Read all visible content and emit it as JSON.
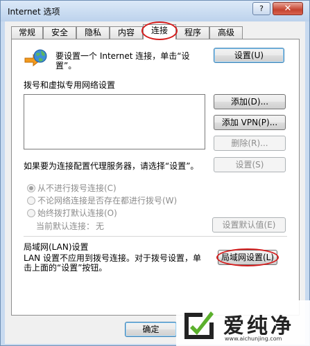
{
  "window": {
    "title": "Internet 选项",
    "help_label": "?",
    "close_label": "✕"
  },
  "tabs": [
    {
      "label": "常规"
    },
    {
      "label": "安全"
    },
    {
      "label": "隐私"
    },
    {
      "label": "内容"
    },
    {
      "label": "连接",
      "active": true
    },
    {
      "label": "程序"
    },
    {
      "label": "高级"
    }
  ],
  "setup": {
    "text_line1": "要设置一个 Internet 连接，单击“设",
    "text_line2": "置”。",
    "button": "设置(U)"
  },
  "dialup": {
    "heading": "拨号和虚拟专用网络设置",
    "add_button": "添加(D)...",
    "add_vpn_button": "添加 VPN(P)...",
    "delete_button": "删除(R)...",
    "proxy_text": "如果要为连接配置代理服务器，请选择“设置”。",
    "settings_button": "设置(S)",
    "radios": [
      {
        "label": "从不进行拨号连接(C)",
        "checked": true
      },
      {
        "label": "不论网络连接是否存在都进行拨号(W)",
        "checked": false
      },
      {
        "label": "始终拨打默认连接(O)",
        "checked": false
      }
    ],
    "current_default_label": "当前默认连接：",
    "current_default_value": "无",
    "set_default_button": "设置默认值(E)"
  },
  "lan": {
    "heading": "局域网(LAN)设置",
    "text_line1": "LAN 设置不应用到拨号连接。对于拨号设置，单",
    "text_line2": "击上面的“设置”按钮。",
    "button": "局域网设置(L)"
  },
  "footer": {
    "ok_button": "确定"
  },
  "watermark": {
    "text": "爱纯净",
    "url": "www.aichunjing.com"
  },
  "colors": {
    "annotation": "#d51c1c",
    "title_bar": "#c8daf0"
  }
}
